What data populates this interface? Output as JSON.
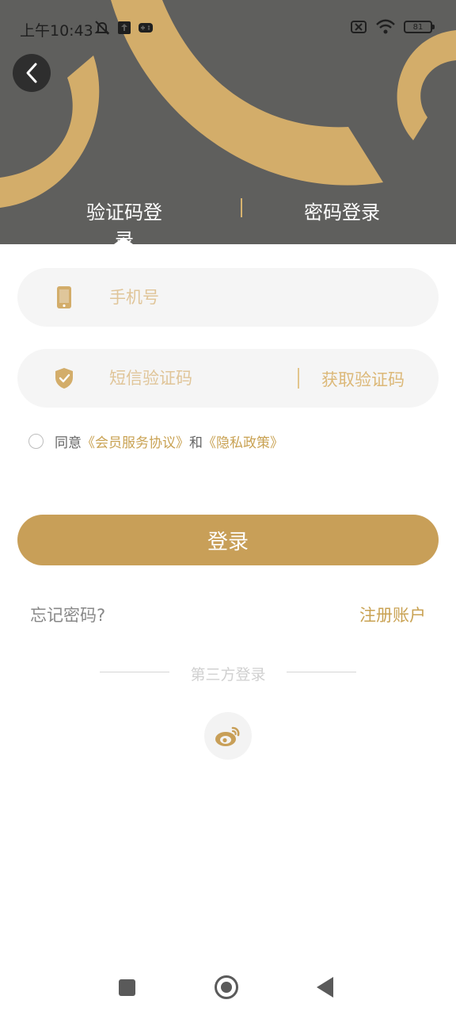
{
  "status_bar": {
    "time": "上午10:43",
    "battery": "81"
  },
  "tabs": [
    {
      "label": "验证码登录",
      "active": true
    },
    {
      "label": "密码登录",
      "active": false
    }
  ],
  "form": {
    "phone_placeholder": "手机号",
    "code_placeholder": "短信验证码",
    "get_code_label": "获取验证码"
  },
  "agreement": {
    "prefix": "同意",
    "member_agreement": "《会员服务协议》",
    "and": "和",
    "privacy_policy": "《隐私政策》"
  },
  "login_button": "登录",
  "forgot_password": "忘记密码?",
  "register_account": "注册账户",
  "third_party": {
    "label": "第三方登录",
    "providers": [
      "weibo-icon"
    ]
  },
  "colors": {
    "header_bg": "#5f5f5d",
    "accent_gold": "#c89f58",
    "arc_gold": "#d3ad6a",
    "field_bg": "#f5f5f5"
  }
}
